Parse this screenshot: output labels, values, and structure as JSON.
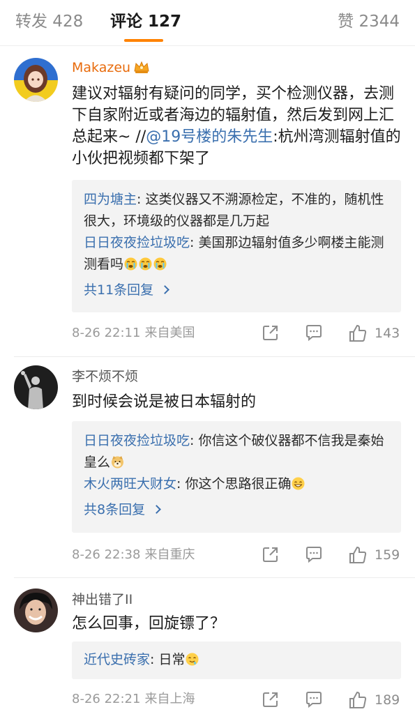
{
  "tabs": {
    "repost": "转发 428",
    "comments": "评论 127",
    "likes": "赞 2344",
    "active_color": "#ff8200"
  },
  "comments": [
    {
      "username": "Makazeu",
      "badge_icon": "vip-crown-icon",
      "text_before": "建议对辐射有疑问的同学，买个检测仪器，去测下自家附近或者海边的辐射值，然后发到网上汇总起来~ //",
      "mention": "@19号楼的朱先生",
      "text_after": ":杭州湾测辐射值的小伙把视频都下架了",
      "replies": [
        {
          "author": "四为塘主",
          "text": ": 这类仪器又不溯源检定，不准的，随机性很大，环境级的仪器都是几万起",
          "emoji": []
        },
        {
          "author": "日日夜夜捡垃圾吃",
          "text": ": 美国那边辐射值多少啊楼主能测测看吗",
          "emoji": [
            "crying-emoji",
            "crying-emoji",
            "crying-emoji"
          ]
        }
      ],
      "more_replies": "共11条回复",
      "time": "8-26 22:11",
      "location": "来自美国",
      "likes": "143"
    },
    {
      "username": "李不烦不烦",
      "text": "到时候会说是被日本辐射的",
      "replies": [
        {
          "author": "日日夜夜捡垃圾吃",
          "text": ": 你信这个破仪器都不信我是秦始皇么",
          "emoji": [
            "doge-emoji"
          ]
        },
        {
          "author": "木火两旺大财女",
          "text": ": 你这个思路很正确",
          "emoji": [
            "grin-emoji"
          ]
        }
      ],
      "more_replies": "共8条回复",
      "time": "8-26 22:38",
      "location": "来自重庆",
      "likes": "159"
    },
    {
      "username": "神出错了II",
      "text": "怎么回事，回旋镖了？",
      "replies": [
        {
          "author": "近代史砖家",
          "text": ": 日常",
          "emoji": [
            "drool-emoji"
          ]
        }
      ],
      "time": "8-26 22:21",
      "location": "来自上海",
      "likes": "189"
    }
  ],
  "colors": {
    "username_vip": "#e86b0c",
    "link_blue": "#3a6fae",
    "meta_gray": "#9a9a9a",
    "reply_bg": "#f3f3f3"
  }
}
